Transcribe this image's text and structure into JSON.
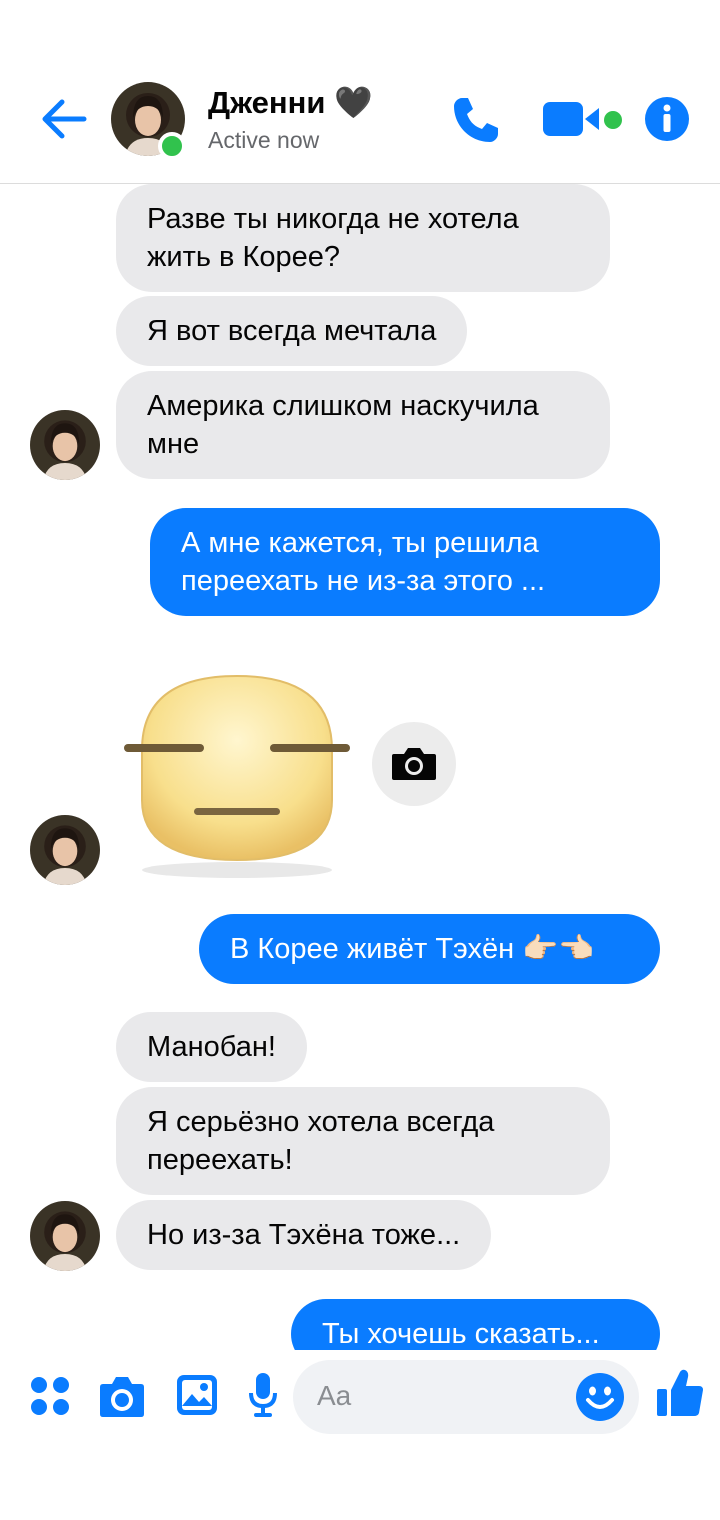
{
  "header": {
    "contact_name": "Дженни 🖤",
    "status": "Active now",
    "icons": [
      "back-arrow-icon",
      "phone-icon",
      "video-icon",
      "info-icon"
    ],
    "accent_color": "#0a7cff",
    "online_color": "#31c24d"
  },
  "messages": [
    {
      "from": "contact",
      "text": "Разве ты никогда не хотела жить в Корее?"
    },
    {
      "from": "contact",
      "text": "Я вот всегда мечтала"
    },
    {
      "from": "contact",
      "text": "Америка слишком наскучила мне"
    },
    {
      "from": "me",
      "text": "А мне кажется, ты решила переехать не из-за этого ..."
    },
    {
      "from": "contact",
      "type": "sticker",
      "sticker": "expressionless-face-sticker"
    },
    {
      "from": "me",
      "text": "В Корее живёт Тэхён 👉🏻👈🏻"
    },
    {
      "from": "contact",
      "text": "Манобан!"
    },
    {
      "from": "contact",
      "text": "Я серьёзно хотела всегда переехать!"
    },
    {
      "from": "contact",
      "text": "Но из-за Тэхёна тоже..."
    },
    {
      "from": "me",
      "text": "Ты хочешь сказать..."
    }
  ],
  "composer": {
    "placeholder": "Aa",
    "icons": [
      "apps-icon",
      "camera-icon",
      "gallery-icon",
      "microphone-icon",
      "emoji-icon",
      "thumbs-up-icon"
    ]
  }
}
